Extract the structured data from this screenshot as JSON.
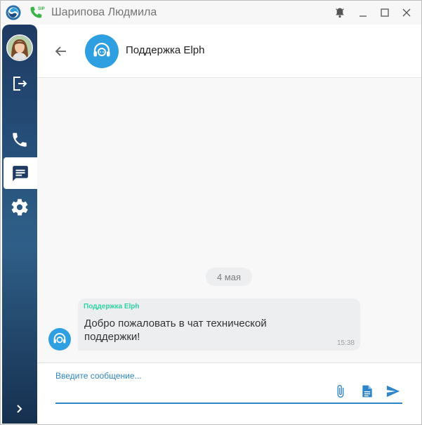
{
  "window": {
    "title": "Шарипова Людмила",
    "sip_badge": "SIP"
  },
  "colors": {
    "accent": "#2e9fe0",
    "sender": "#2fd3a5",
    "sidebar": "#244a6f"
  },
  "icons": {
    "app": "app-logo-icon",
    "sip": "sip-phone-icon",
    "bell": "bell-icon",
    "minimize": "minimize-icon",
    "maximize": "maximize-icon",
    "close": "close-icon",
    "logout": "logout-icon",
    "phone": "phone-icon",
    "chat": "chat-icon",
    "settings": "gear-icon",
    "expand": "chevron-right-icon",
    "back": "arrow-left-icon",
    "support": "headset-icon",
    "attach": "paperclip-icon",
    "document": "document-icon",
    "send": "send-icon"
  },
  "header": {
    "contact_name": "Поддержка Elph"
  },
  "chat": {
    "date_separator": "4 мая",
    "messages": [
      {
        "sender": "Поддержка Elph",
        "text": "Добро пожаловать в чат технической поддержки!",
        "time": "15:38"
      }
    ]
  },
  "composer": {
    "placeholder": "Введите сообщение...",
    "value": ""
  }
}
